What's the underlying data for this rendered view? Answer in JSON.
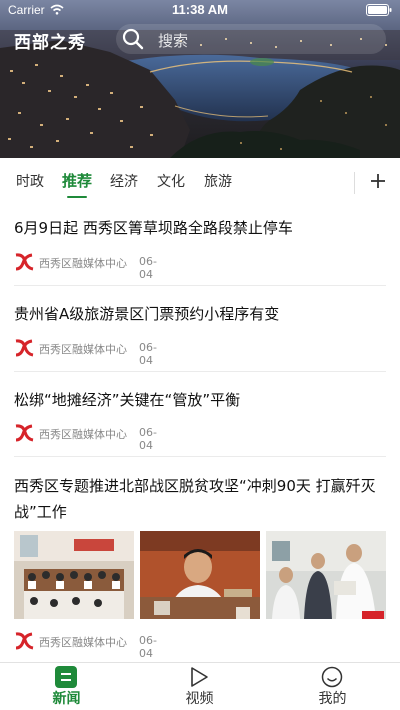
{
  "status_bar": {
    "carrier": "Carrier",
    "time": "11:38 AM"
  },
  "header": {
    "app_title": "西部之秀",
    "search_placeholder": "搜索"
  },
  "tabs": [
    {
      "label": "时政",
      "active": false
    },
    {
      "label": "推荐",
      "active": true
    },
    {
      "label": "经济",
      "active": false
    },
    {
      "label": "文化",
      "active": false
    },
    {
      "label": "旅游",
      "active": false
    }
  ],
  "articles": [
    {
      "title": "6月9日起 西秀区箐草坝路全路段禁止停车",
      "source": "西秀区融媒体中心",
      "date": "06-04"
    },
    {
      "title": "贵州省A级旅游景区门票预约小程序有变",
      "source": "西秀区融媒体中心",
      "date": "06-04"
    },
    {
      "title": "松绑“地摊经济”关键在“管放”平衡",
      "source": "西秀区融媒体中心",
      "date": "06-04"
    },
    {
      "title": "西秀区专题推进北部战区脱贫攻坚“冲刺90天 打赢歼灭战”工作",
      "source": "西秀区融媒体中心",
      "date": "06-04"
    }
  ],
  "bottom_nav": [
    {
      "label": "新闻",
      "icon": "news-icon",
      "active": true
    },
    {
      "label": "视频",
      "icon": "video-play-icon",
      "active": false
    },
    {
      "label": "我的",
      "icon": "profile-smile-icon",
      "active": false
    }
  ],
  "colors": {
    "accent": "#1f8a3a",
    "logo_red": "#d6242a",
    "meta_gray": "#888888"
  }
}
